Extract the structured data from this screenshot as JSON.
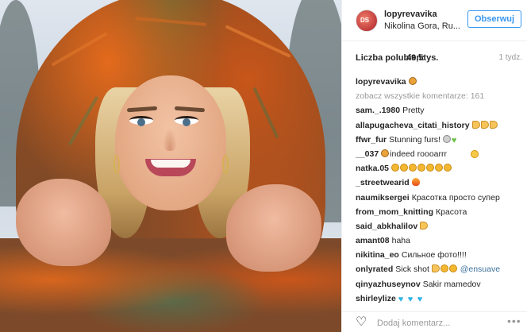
{
  "header": {
    "username": "lopyrevavika",
    "location": "Nikolina Gora, Ru...",
    "follow_label": "Obserwuj",
    "avatar_text": "DS"
  },
  "likes": {
    "label": "Liczba polubień:",
    "count": "49,5tys.",
    "time": "1 tydz."
  },
  "caption": {
    "username": "lopyrevavika",
    "emoji": [
      "lion"
    ]
  },
  "view_all": "zobacz wszystkie komentarze: 161",
  "comments": [
    {
      "user": "sam._.1980",
      "text": "Pretty",
      "emoji": []
    },
    {
      "user": "allapugacheva_citati_history",
      "text": "",
      "emoji": [
        "thumb",
        "thumb",
        "thumb"
      ]
    },
    {
      "user": "ffwr_fur",
      "text": "Stunning furs!",
      "emoji": [
        "cat",
        "heart-green"
      ]
    },
    {
      "user": "__037",
      "text": "indeed roooarrr",
      "emoji_before": [
        "lion"
      ]
    },
    {
      "user": "natka.05",
      "text": "",
      "emoji": [
        "clap",
        "clap",
        "clap",
        "clap",
        "clap",
        "clap",
        "clap"
      ]
    },
    {
      "user": "_streetwearid",
      "text": "",
      "emoji": [
        "fire"
      ]
    },
    {
      "user": "naumiksergei",
      "text": "Красотка просто супер",
      "emoji": []
    },
    {
      "user": "from_mom_knitting",
      "text": "Красота",
      "emoji": [
        "face"
      ]
    },
    {
      "user": "said_abkhalilov",
      "text": "",
      "emoji": [
        "face",
        "thumb"
      ]
    },
    {
      "user": "amant08",
      "text": "haha",
      "emoji": []
    },
    {
      "user": "nikitina_eo",
      "text": "Сильное фото!!!!",
      "emoji": []
    },
    {
      "user": "onlyrated",
      "text": "Sick shot",
      "emoji": [
        "thumb",
        "clap",
        "clap"
      ],
      "mention": "@ensuave"
    },
    {
      "user": "qinyazhuseynov",
      "text": "Sakir mamedov",
      "emoji": []
    },
    {
      "user": "shirleylize",
      "text": "",
      "emoji": [
        "heart-blue",
        "heart-blue",
        "heart-blue"
      ]
    }
  ],
  "footer": {
    "placeholder": "Dodaj komentarz...",
    "more": "•••"
  },
  "colors": {
    "accent": "#3897f0",
    "muted": "#999999",
    "mention": "#3f729b"
  }
}
